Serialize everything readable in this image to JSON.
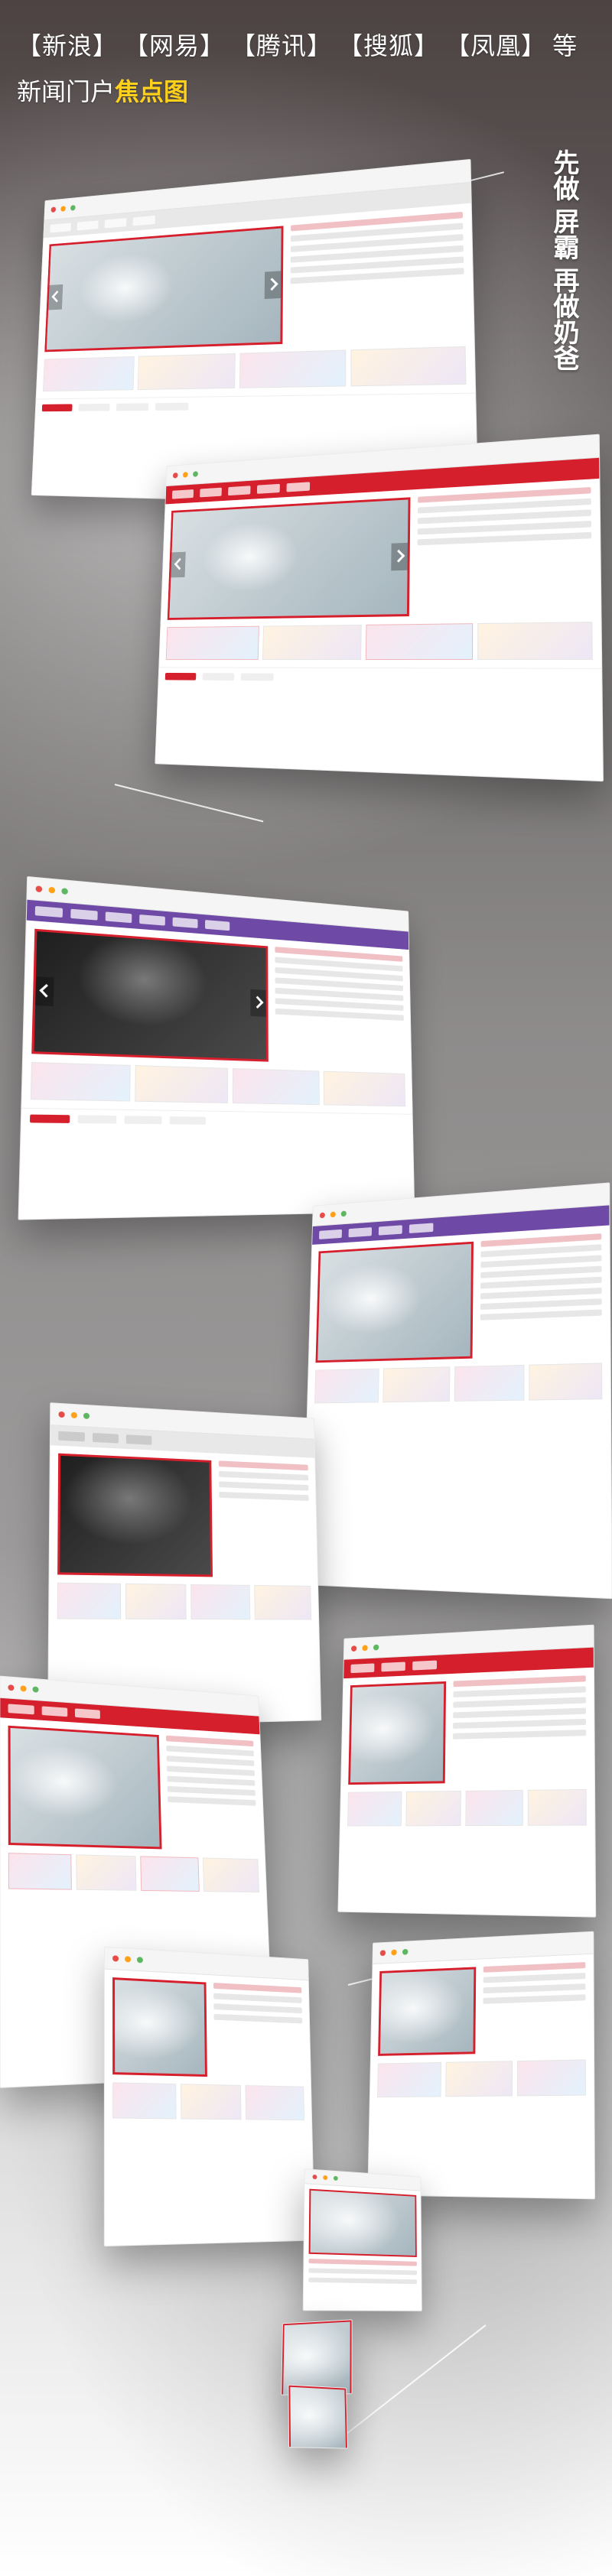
{
  "top_banner": {
    "portals": [
      "【新浪】",
      "【网易】",
      "【腾讯】",
      "【搜狐】",
      "【凤凰】"
    ],
    "portals_suffix": "等",
    "line2_prefix": "新闻门户",
    "line2_highlight": "焦点图",
    "highlight_color": "#ffd11a"
  },
  "side_text": {
    "part1": "先做",
    "part2": "屏霸",
    "part3": "再做奶爸"
  },
  "colors": {
    "accent_red": "#d61f2c",
    "accent_purple": "#6e4aa6"
  }
}
